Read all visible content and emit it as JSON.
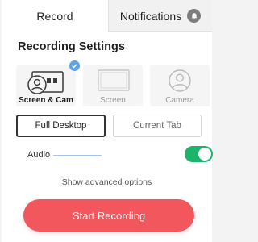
{
  "tabs": {
    "record_label": "Record",
    "notifications_label": "Notifications"
  },
  "settings": {
    "heading": "Recording Settings"
  },
  "modes": [
    {
      "label": "Screen & Cam",
      "icon": "screen-cam-icon",
      "selected": true
    },
    {
      "label": "Screen",
      "icon": "screen-icon",
      "selected": false
    },
    {
      "label": "Camera",
      "icon": "camera-user-icon",
      "selected": false
    }
  ],
  "display": {
    "full_label": "Full Desktop",
    "tab_label": "Current Tab",
    "selected": "Full Desktop"
  },
  "audio": {
    "label": "Audio",
    "enabled": true
  },
  "advanced_label": "Show advanced options",
  "start_label": "Start Recording",
  "colors": {
    "accent": "#f1575d",
    "toggle_on": "#1eb26a",
    "check": "#5da3e7"
  }
}
